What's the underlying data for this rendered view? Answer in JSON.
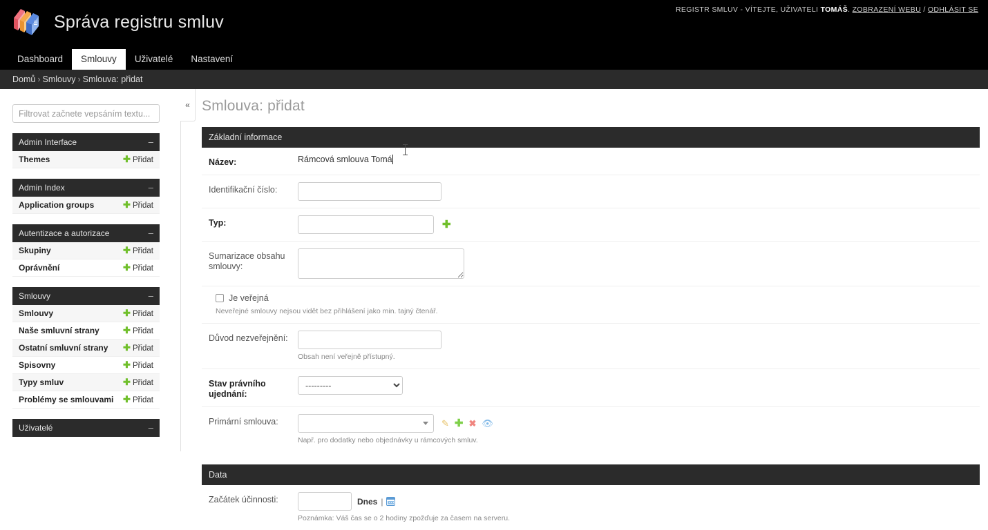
{
  "header": {
    "site_title": "Správa registru smluv",
    "logo_icon": "books-logo-icon",
    "user_tools": {
      "prefix": "REGISTR SMLUV - VÍTEJTE, UŽIVATELI",
      "username": "TOMÁŠ",
      "period": ".",
      "view_site": "ZOBRAZENÍ WEBU",
      "separator": "/",
      "logout": "ODHLÁSIT SE"
    },
    "tabs": [
      {
        "label": "Dashboard",
        "active": false
      },
      {
        "label": "Smlouvy",
        "active": true
      },
      {
        "label": "Uživatelé",
        "active": false
      },
      {
        "label": "Nastavení",
        "active": false
      }
    ]
  },
  "breadcrumbs": {
    "home": "Domů",
    "sep": "›",
    "section": "Smlouvy",
    "current": "Smlouva: přidat"
  },
  "sidebar": {
    "filter_placeholder": "Filtrovat začnete vepsáním textu...",
    "collapse_label": "«",
    "collapse_toggle": "–",
    "add_label": "Přidat",
    "modules": [
      {
        "title": "Admin Interface",
        "models": [
          {
            "name": "Themes"
          }
        ]
      },
      {
        "title": "Admin Index",
        "models": [
          {
            "name": "Application groups"
          }
        ]
      },
      {
        "title": "Autentizace a autorizace",
        "models": [
          {
            "name": "Skupiny"
          },
          {
            "name": "Oprávnění"
          }
        ]
      },
      {
        "title": "Smlouvy",
        "models": [
          {
            "name": "Smlouvy"
          },
          {
            "name": "Naše smluvní strany"
          },
          {
            "name": "Ostatní smluvní strany"
          },
          {
            "name": "Spisovny"
          },
          {
            "name": "Typy smluv"
          },
          {
            "name": "Problémy se smlouvami"
          }
        ]
      },
      {
        "title": "Uživatelé",
        "models": []
      }
    ]
  },
  "content": {
    "title": "Smlouva: přidat",
    "fieldsets": [
      {
        "legend": "Základní informace"
      },
      {
        "legend": "Data"
      }
    ],
    "fields": {
      "nazev": {
        "label": "Název:",
        "value": "Rámcová smlouva Tomá",
        "focused": true
      },
      "identifikacni_cislo": {
        "label": "Identifikační číslo:",
        "value": ""
      },
      "typ": {
        "label": "Typ:",
        "value": "",
        "add_icon": "plus-icon"
      },
      "sumarizace": {
        "label": "Sumarizace obsahu smlouvy:",
        "value": ""
      },
      "je_verejna": {
        "label": "Je veřejná",
        "checked": false,
        "help": "Neveřejné smlouvy nejsou vidět bez přihlášení jako min. tajný čtenář."
      },
      "duvod_nezverejneni": {
        "label": "Důvod nezveřejnění:",
        "value": "",
        "help": "Obsah není veřejně přístupný."
      },
      "stav_pravniho_ujednani": {
        "label": "Stav právního ujednání:",
        "selected": "---------",
        "options": [
          "---------"
        ]
      },
      "primarni_smlouva": {
        "label": "Primární smlouva:",
        "value": "",
        "help": "Např. pro dodatky nebo objednávky u rámcových smluv.",
        "tools": [
          {
            "icon": "edit-pencil-icon"
          },
          {
            "icon": "plus-icon"
          },
          {
            "icon": "delete-x-icon"
          },
          {
            "icon": "view-eye-icon"
          }
        ]
      },
      "zacatek_ucinnosti": {
        "label": "Začátek účinnosti:",
        "value": "",
        "today_label": "Dnes",
        "pipe": "|",
        "calendar_icon": "calendar-icon",
        "help": "Poznámka: Váš čas se o 2 hodiny zpožďuje za časem na serveru."
      }
    }
  },
  "colors": {
    "header_bg": "#000000",
    "breadcrumb_bg": "#2b2b2b",
    "module_header_bg": "#2b2b2b",
    "accent_green": "#70bf2b",
    "focus_border": "#6554C0",
    "title_grey": "#9a9a9a"
  }
}
